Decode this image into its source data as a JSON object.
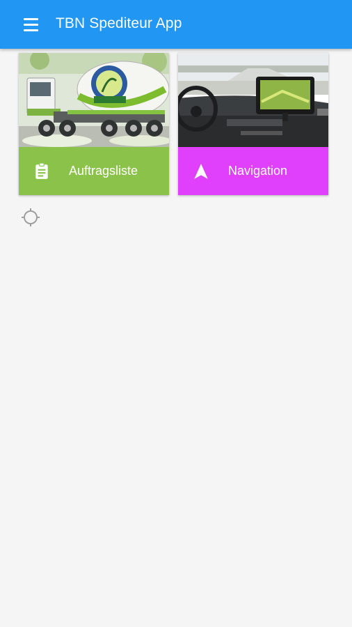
{
  "app": {
    "title": "TBN Spediteur App"
  },
  "colors": {
    "appbar": "#2196f3",
    "tile_orders": "#8bc34a",
    "tile_navigation": "#e040fb",
    "background": "#f5f5f5"
  },
  "tiles": [
    {
      "label": "Auftragsliste",
      "icon": "clipboard-icon",
      "image": "concrete-mixer-truck-photo"
    },
    {
      "label": "Navigation",
      "icon": "navigation-arrow-icon",
      "image": "truck-cab-gps-photo"
    }
  ],
  "location_icon": "crosshair-icon"
}
